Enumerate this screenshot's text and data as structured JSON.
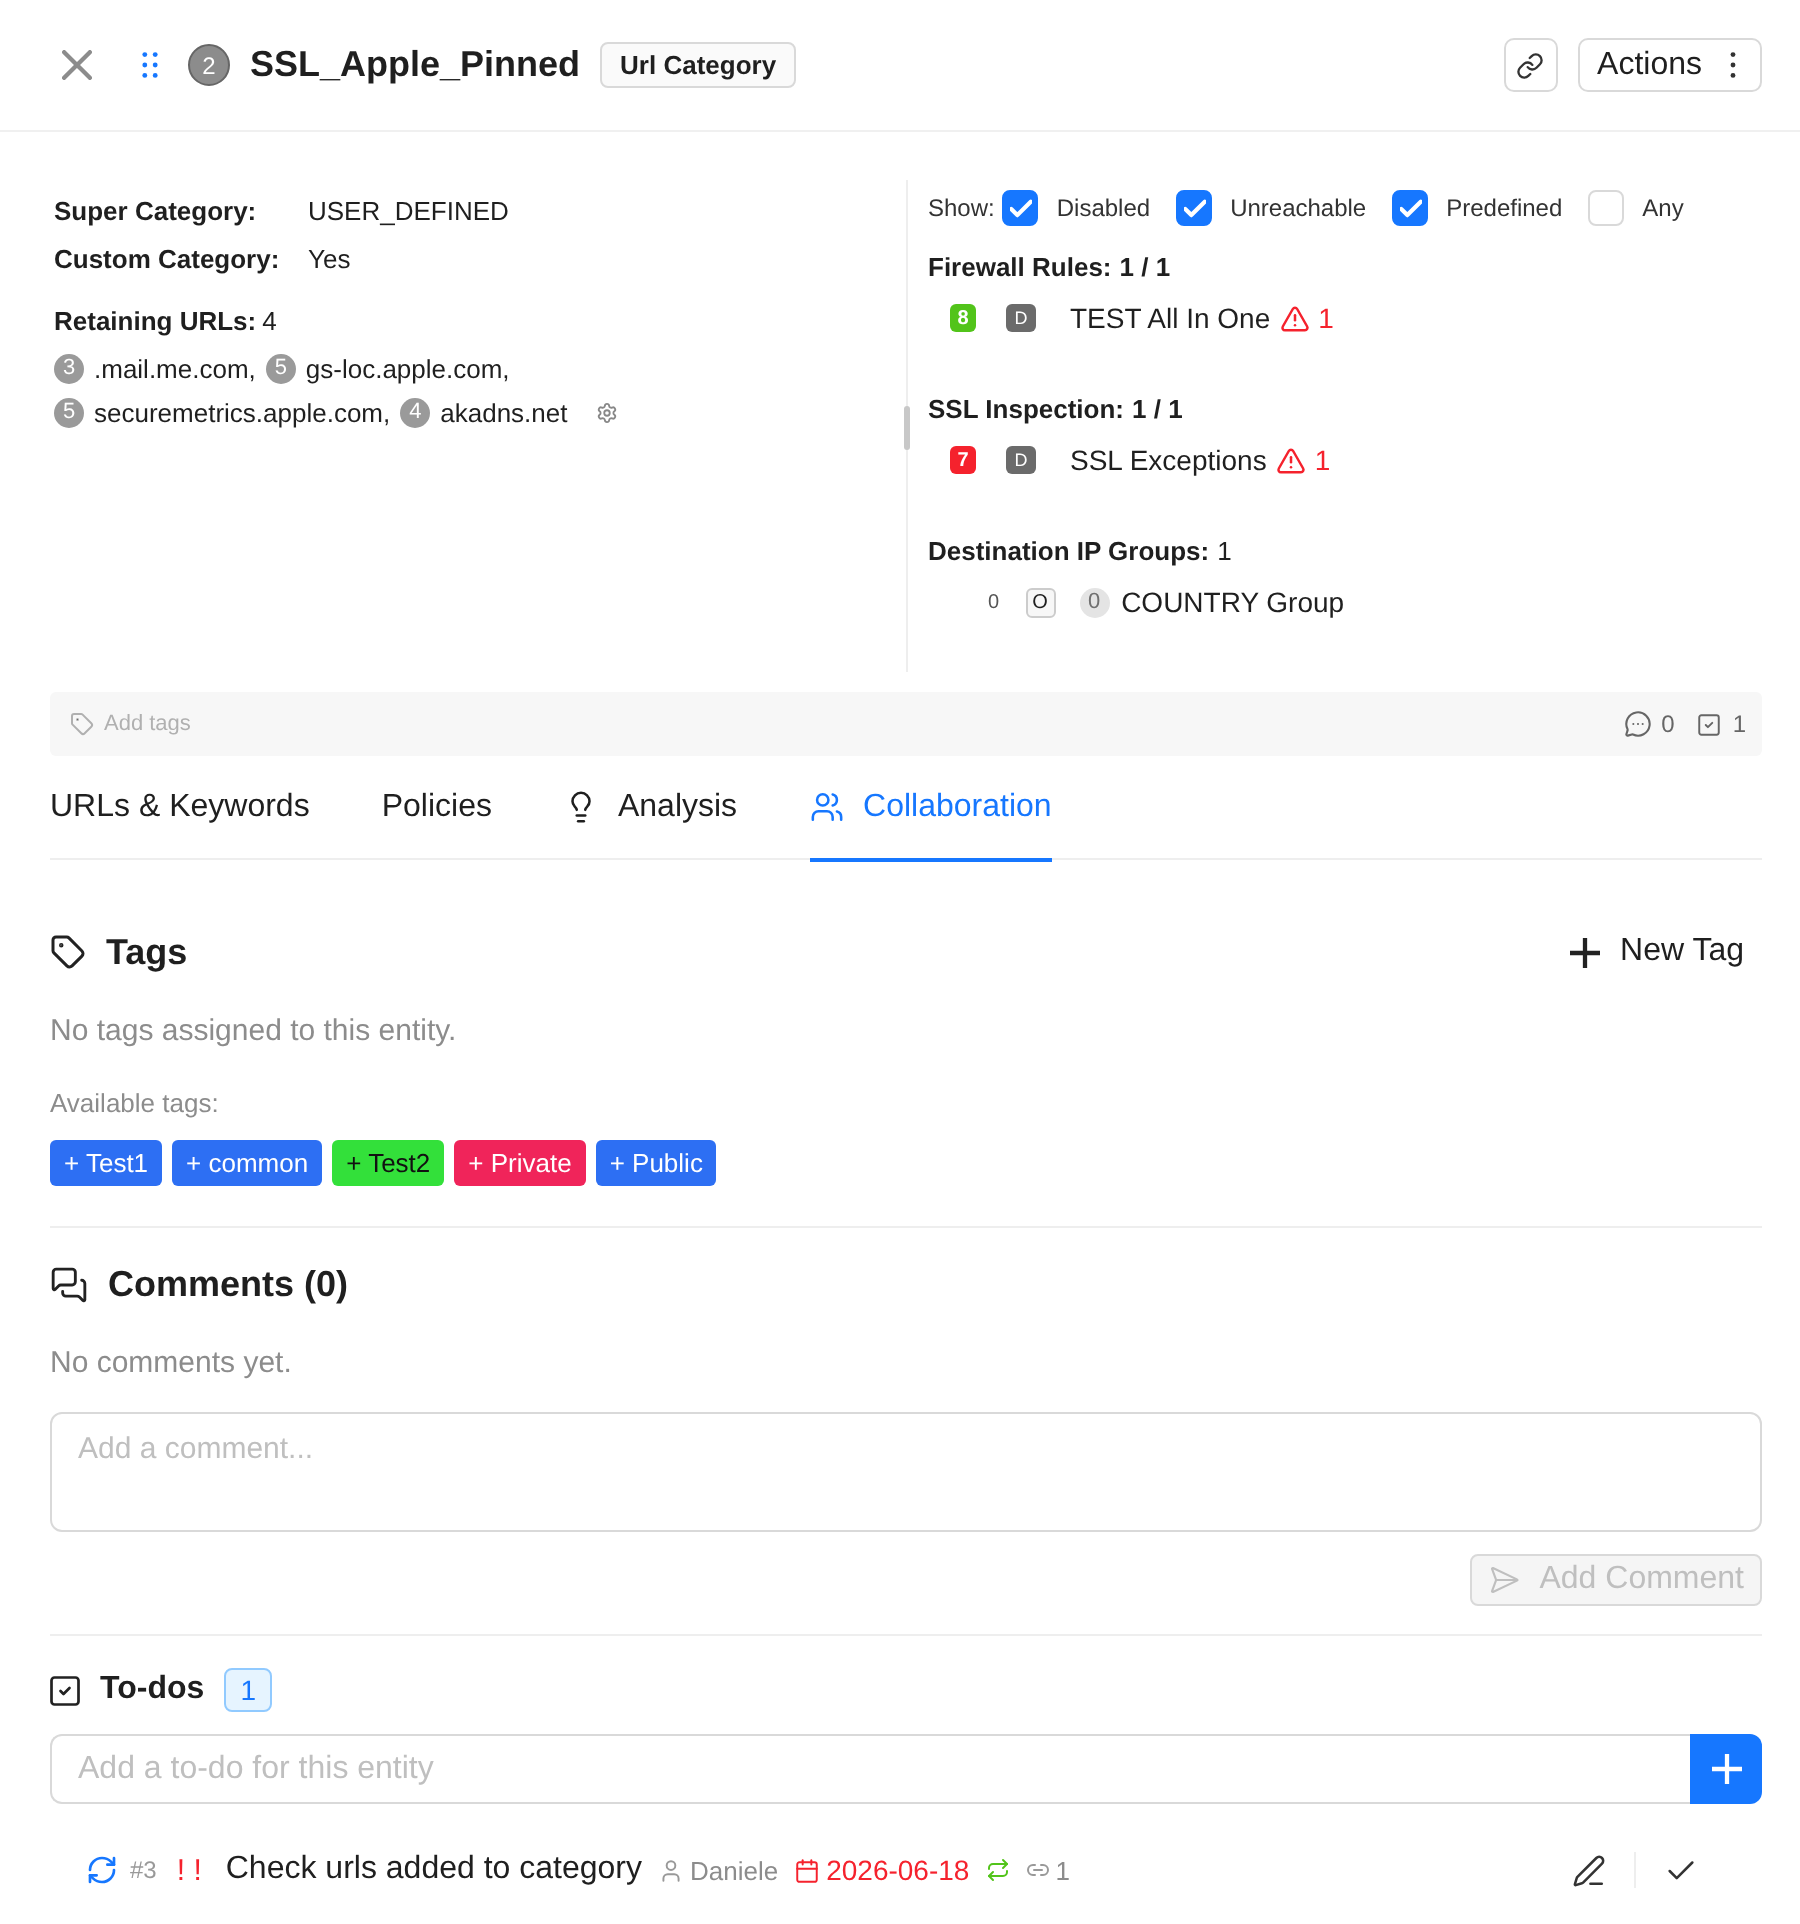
{
  "header": {
    "count": "2",
    "title": "SSL_Apple_Pinned",
    "type_label": "Url Category",
    "actions_label": "Actions"
  },
  "details": {
    "fields": [
      {
        "label": "Super Category:",
        "value": "USER_DEFINED"
      },
      {
        "label": "Custom Category:",
        "value": "Yes"
      }
    ],
    "retaining": {
      "label": "Retaining URLs:",
      "value": "4",
      "urls": [
        {
          "count": "3",
          "url": ".mail.me.com,"
        },
        {
          "count": "5",
          "url": "gs-loc.apple.com,"
        },
        {
          "count": "5",
          "url": "securemetrics.apple.com,"
        },
        {
          "count": "4",
          "url": "akadns.net"
        }
      ]
    }
  },
  "filters": {
    "label": "Show:",
    "options": [
      {
        "label": "Disabled",
        "checked": true
      },
      {
        "label": "Unreachable",
        "checked": true
      },
      {
        "label": "Predefined",
        "checked": true
      },
      {
        "label": "Any",
        "checked": false
      }
    ]
  },
  "groups": [
    {
      "kind": "rules",
      "label": "Firewall Rules:",
      "count": "1 / 1",
      "items": [
        {
          "order": "8",
          "color": "#52c41a",
          "state": "D",
          "name": "TEST All In One",
          "warnings": "1"
        }
      ]
    },
    {
      "kind": "rules",
      "label": "SSL Inspection:",
      "count": "1 / 1",
      "items": [
        {
          "order": "7",
          "color": "#f5222d",
          "state": "D",
          "name": "SSL Exceptions",
          "warnings": "1"
        }
      ]
    },
    {
      "kind": "ip_groups",
      "label": "Destination IP Groups:",
      "count": "1",
      "items": [
        {
          "count": "0",
          "state": "O",
          "order": "0",
          "name": "COUNTRY Group"
        }
      ]
    }
  ],
  "tags_bar": {
    "placeholder": "Add tags",
    "comments": "0",
    "todos": "1"
  },
  "tabs": [
    {
      "label": "URLs & Keywords",
      "selected": false
    },
    {
      "label": "Policies",
      "selected": false
    },
    {
      "label": "Analysis",
      "selected": false
    },
    {
      "label": "Collaboration",
      "selected": true
    }
  ],
  "tags": {
    "title": "Tags",
    "new_label": "New Tag",
    "empty": "No tags assigned to this entity.",
    "available_label": "Available tags:",
    "available": [
      {
        "label": "+ Test1",
        "color": "#2d6ff3"
      },
      {
        "label": "+ common",
        "color": "#2d6ff3"
      },
      {
        "label": "+ Test2",
        "color": "#33e03a"
      },
      {
        "label": "+ Private",
        "color": "#f0245a"
      },
      {
        "label": "+ Public",
        "color": "#2d6ff3"
      }
    ]
  },
  "comments": {
    "title": "Comments (0)",
    "empty": "No comments yet.",
    "placeholder": "Add a comment...",
    "submit": {
      "label": "Add Comment",
      "disabled": true
    }
  },
  "todos": {
    "title": "To-dos",
    "count": "1",
    "placeholder": "Add a to-do for this entity",
    "items": [
      {
        "number": "#3",
        "priority": "! !",
        "title": "Check urls added to category",
        "assignee": "Daniele",
        "due": "2026-06-18",
        "links": "1"
      }
    ]
  }
}
